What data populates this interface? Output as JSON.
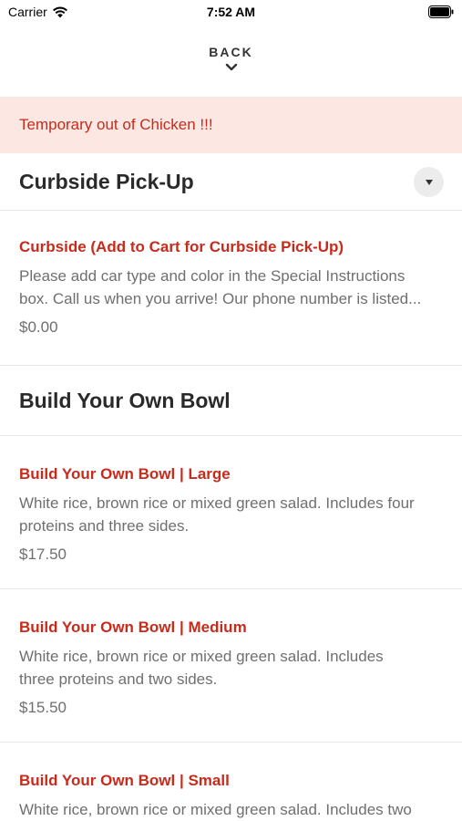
{
  "status": {
    "carrier": "Carrier",
    "time": "7:52 AM"
  },
  "nav": {
    "back_label": "BACK"
  },
  "notice": {
    "text": "Temporary out of Chicken !!!"
  },
  "sections": [
    {
      "title": "Curbside Pick-Up",
      "items": [
        {
          "name": "Curbside (Add to Cart for Curbside Pick-Up)",
          "desc_line1": "Please add car type and color in the Special Instructions",
          "desc_line2": "box. Call us when you arrive! Our phone number is listed...",
          "price": "$0.00"
        }
      ]
    },
    {
      "title": "Build Your Own Bowl",
      "items": [
        {
          "name": "Build Your Own Bowl | Large",
          "desc_line1": "White rice, brown rice or mixed green salad. Includes four",
          "desc_line2": "proteins and three sides.",
          "price": "$17.50"
        },
        {
          "name": "Build Your Own Bowl | Medium",
          "desc_line1": "White rice, brown rice or mixed green salad. Includes",
          "desc_line2": "three proteins and two sides.",
          "price": "$15.50"
        },
        {
          "name": "Build Your Own Bowl | Small",
          "desc_line1": "White rice, brown rice or mixed green salad. Includes two"
        }
      ]
    }
  ],
  "icons": {
    "wifi": "wifi-icon",
    "battery": "battery-icon",
    "back": "chevron-down-icon",
    "collapse": "caret-down-icon"
  },
  "colors": {
    "accent": "#c62b1c",
    "notice_bg": "#fde7e3",
    "muted_text": "#6f6f6f"
  }
}
